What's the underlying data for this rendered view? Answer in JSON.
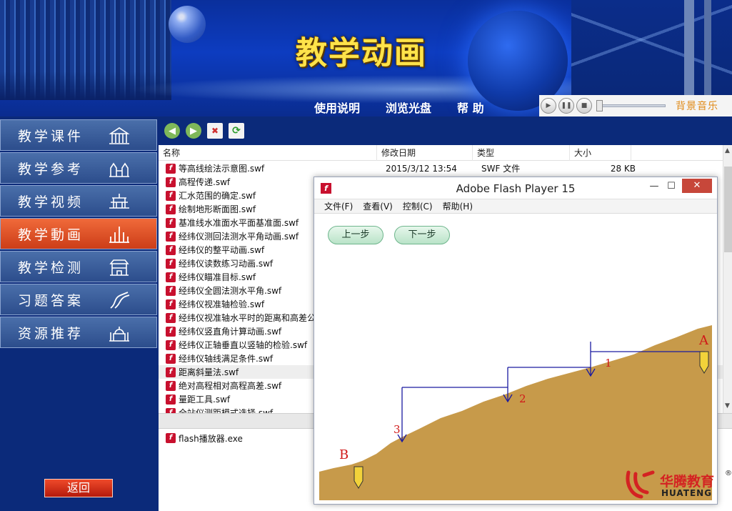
{
  "header": {
    "title": "教学动画"
  },
  "topnav": [
    "使用说明",
    "浏览光盘",
    "帮 助"
  ],
  "music": {
    "label": "背景音乐"
  },
  "menu": {
    "items": [
      {
        "label": "教学课件",
        "active": false
      },
      {
        "label": "教学参考",
        "active": false
      },
      {
        "label": "教学视频",
        "active": false
      },
      {
        "label": "教学動画",
        "active": true
      },
      {
        "label": "教学检测",
        "active": false
      },
      {
        "label": "习题答案",
        "active": false
      },
      {
        "label": "资源推荐",
        "active": false
      }
    ],
    "back_label": "返回"
  },
  "explorer": {
    "columns": [
      "名称",
      "修改日期",
      "类型",
      "大小"
    ],
    "rows": [
      {
        "name": "等高线绘法示意图.swf",
        "date": "2015/3/12 13:54",
        "type": "SWF 文件",
        "size": "28 KB"
      },
      {
        "name": "高程传递.swf"
      },
      {
        "name": "汇水范围的确定.swf"
      },
      {
        "name": "绘制地形断面图.swf"
      },
      {
        "name": "基准线水准面水平面基准面.swf"
      },
      {
        "name": "经纬仪测回法测水平角动画.swf"
      },
      {
        "name": "经纬仪的整平动画.swf"
      },
      {
        "name": "经纬仪读数练习动画.swf"
      },
      {
        "name": "经纬仪瞄准目标.swf"
      },
      {
        "name": "经纬仪全圆法测水平角.swf"
      },
      {
        "name": "经纬仪视准轴检验.swf"
      },
      {
        "name": "经纬仪视准轴水平时的距离和高差公"
      },
      {
        "name": "经纬仪竖直角计算动画.swf"
      },
      {
        "name": "经纬仪正轴垂直以竖轴的检验.swf"
      },
      {
        "name": "经纬仪轴线满足条件.swf"
      },
      {
        "name": "距离斜量法.swf",
        "highlight": true
      },
      {
        "name": "绝对高程相对高程高差.swf"
      },
      {
        "name": "量距工具.swf"
      },
      {
        "name": "全站仪测距模式选择.swf"
      }
    ],
    "lower_file": "flash播放器.exe"
  },
  "flash": {
    "title": "Adobe Flash Player 15",
    "menu": [
      "文件(F)",
      "查看(V)",
      "控制(C)",
      "帮助(H)"
    ],
    "prev_label": "上一步",
    "next_label": "下一步",
    "points": {
      "A": "A",
      "B": "B",
      "n1": "1",
      "n2": "2",
      "n3": "3"
    },
    "terrain_color": "#c79a4a",
    "arrow_color": "#1a1aa0",
    "label_color": "#d01818"
  },
  "brand": {
    "cn": "华腾教育",
    "en": "HUATENG",
    "reg": "®"
  }
}
